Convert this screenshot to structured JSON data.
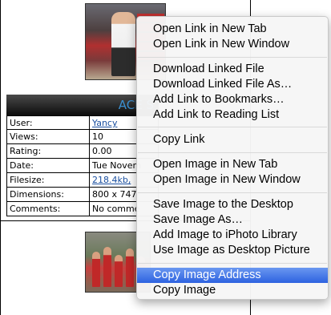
{
  "page": {
    "table_title": "ACE S",
    "rows": [
      {
        "label": "User:",
        "value": "Yancy",
        "link": true
      },
      {
        "label": "Views:",
        "value": "10",
        "link": false
      },
      {
        "label": "Rating:",
        "value": "0.00",
        "link": false
      },
      {
        "label": "Date:",
        "value": "Tue Novem",
        "link": false
      },
      {
        "label": "Filesize:",
        "value": "218.4kb, ",
        "link": true
      },
      {
        "label": "Dimensions:",
        "value": "800 x 747",
        "link": false
      },
      {
        "label": "Comments:",
        "value": "No comme",
        "link": false
      }
    ]
  },
  "context_menu": {
    "items": [
      "Open Link in New Tab",
      "Open Link in New Window",
      "Download Linked File",
      "Download Linked File As…",
      "Add Link to Bookmarks…",
      "Add Link to Reading List",
      "Copy Link",
      "Open Image in New Tab",
      "Open Image in New Window",
      "Save Image to the Desktop",
      "Save Image As…",
      "Add Image to iPhoto Library",
      "Use Image as Desktop Picture",
      "Copy Image Address",
      "Copy Image"
    ],
    "highlighted": "Copy Image Address",
    "highlight_color": "#3a6fe6"
  }
}
